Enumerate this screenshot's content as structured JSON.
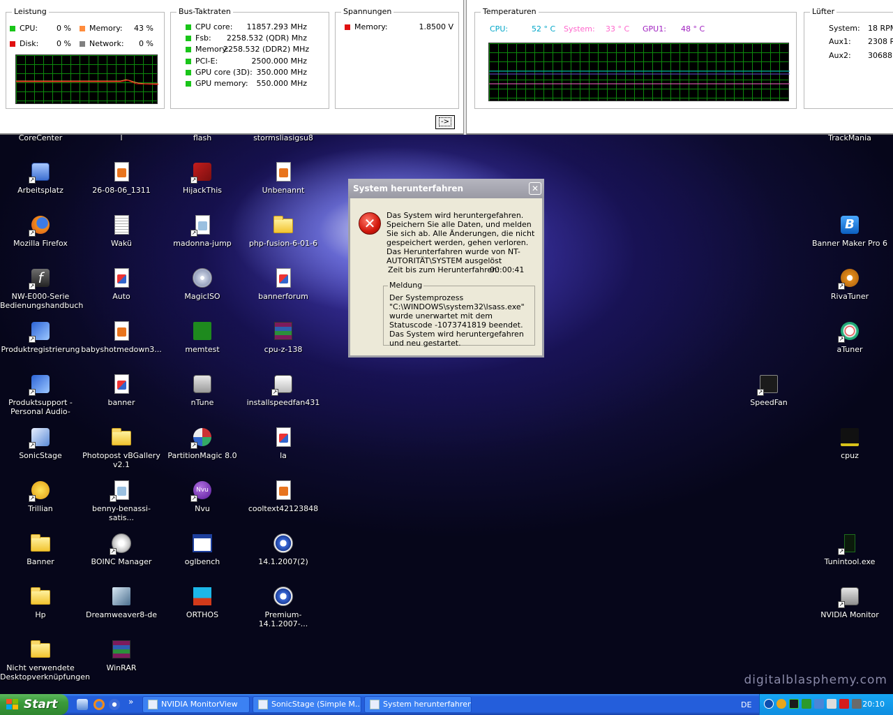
{
  "monitor": {
    "leistung": {
      "caption": "Leistung",
      "cpu_label": "CPU:",
      "cpu_value": "0 %",
      "memory_label": "Memory:",
      "memory_value": "43 %",
      "disk_label": "Disk:",
      "disk_value": "0 %",
      "network_label": "Network:",
      "network_value": "0 %"
    },
    "bus": {
      "caption": "Bus-Taktraten",
      "items": [
        {
          "label": "CPU core:",
          "value": "11857.293 MHz"
        },
        {
          "label": "Fsb:",
          "value": "2258.532 (QDR) Mhz"
        },
        {
          "label": "Memory:",
          "value": "2258.532 (DDR2) MHz"
        },
        {
          "label": "PCI-E:",
          "value": "2500.000 MHz"
        },
        {
          "label": "GPU core (3D):",
          "value": "350.000 MHz"
        },
        {
          "label": "GPU memory:",
          "value": "550.000 MHz"
        }
      ]
    },
    "spannungen": {
      "caption": "Spannungen",
      "label": "Memory:",
      "value": "1.8500 V"
    },
    "arrow_button": "->",
    "temperaturen": {
      "caption": "Temperaturen",
      "cpu_label": "CPU:",
      "cpu_value": "52 ° C",
      "system_label": "System:",
      "system_value": "33 ° C",
      "gpu_label": "GPU1:",
      "gpu_value": "48 ° C"
    },
    "luefter": {
      "caption": "Lüfter",
      "items": [
        {
          "label": "System:",
          "value": "18 RPM"
        },
        {
          "label": "Aux1:",
          "value": "2308 RP"
        },
        {
          "label": "Aux2:",
          "value": "30688 R"
        }
      ]
    },
    "colors": {
      "green": "#19c519",
      "orange": "#ff8c3c",
      "red": "#e01010",
      "gray": "#808080",
      "cyan": "#00a6c8",
      "pink": "#ff66cc",
      "purple": "#a020c0"
    }
  },
  "desktop": {
    "top_labels": [
      "CoreCenter",
      "l",
      "flash",
      "stormsliasigsu8",
      "TrackMania"
    ],
    "icons": [
      {
        "label": "Arbeitsplatz",
        "icon": "computer-icon"
      },
      {
        "label": "26-08-06_1311",
        "icon": "image-file-icon"
      },
      {
        "label": "HijackThis",
        "icon": "hijackthis-icon"
      },
      {
        "label": "Unbenannt",
        "icon": "image-file-icon"
      },
      {
        "label": "Mozilla Firefox",
        "icon": "firefox-icon"
      },
      {
        "label": "Wakü",
        "icon": "text-file-icon"
      },
      {
        "label": "madonna-jump",
        "icon": "media-shortcut-icon"
      },
      {
        "label": "php-fusion-6-01-6",
        "icon": "folder-icon"
      },
      {
        "label": "NW-E000-Serie Bedienungshandbuch",
        "icon": "flash-icon"
      },
      {
        "label": "Auto",
        "icon": "image-file-icon"
      },
      {
        "label": "MagicISO",
        "icon": "disc-icon"
      },
      {
        "label": "bannerforum",
        "icon": "image-file-icon"
      },
      {
        "label": "Produktregistrierung",
        "icon": "sony-icon"
      },
      {
        "label": "babyshotmedown3...",
        "icon": "image-file-icon"
      },
      {
        "label": "memtest",
        "icon": "memtest-icon"
      },
      {
        "label": "cpu-z-138",
        "icon": "winrar-icon"
      },
      {
        "label": "Produktsupport -Personal Audio-",
        "icon": "sony-icon"
      },
      {
        "label": "banner",
        "icon": "image-file-icon"
      },
      {
        "label": "nTune",
        "icon": "nvidia-icon"
      },
      {
        "label": "installspeedfan431",
        "icon": "installer-icon"
      },
      {
        "label": "SonicStage",
        "icon": "sonicstage-icon"
      },
      {
        "label": "Photopost vBGallery v2.1",
        "icon": "folder-icon"
      },
      {
        "label": "PartitionMagic 8.0",
        "icon": "partitionmagic-icon"
      },
      {
        "label": "la",
        "icon": "image-file-icon"
      },
      {
        "label": "Trillian",
        "icon": "trillian-icon"
      },
      {
        "label": "benny-benassi-satis...",
        "icon": "media-shortcut-icon"
      },
      {
        "label": "Nvu",
        "icon": "nvu-icon"
      },
      {
        "label": "cooltext42123848",
        "icon": "image-file-icon"
      },
      {
        "label": "Banner",
        "icon": "folder-icon"
      },
      {
        "label": "BOINC Manager",
        "icon": "boinc-icon"
      },
      {
        "label": "oglbench",
        "icon": "window-icon"
      },
      {
        "label": "14.1.2007(2)",
        "icon": "media-player-icon"
      },
      {
        "label": "Hp",
        "icon": "folder-icon"
      },
      {
        "label": "Dreamweaver8-de",
        "icon": "dreamweaver-icon"
      },
      {
        "label": "ORTHOS",
        "icon": "orthos-icon"
      },
      {
        "label": "Premium-14.1.2007-...",
        "icon": "media-player-icon"
      },
      {
        "label": "Nicht verwendete Desktopverknüpfungen",
        "icon": "folder-icon"
      },
      {
        "label": "WinRAR",
        "icon": "winrar-icon"
      }
    ],
    "right_icons": [
      {
        "label": "Banner Maker Pro 6",
        "icon": "banner-maker-icon"
      },
      {
        "label": "RivaTuner",
        "icon": "rivatuner-icon"
      },
      {
        "label": "aTuner",
        "icon": "atuner-icon"
      },
      {
        "label": "SpeedFan",
        "icon": "speedfan-icon"
      },
      {
        "label": "cpuz",
        "icon": "cpuz-icon"
      },
      {
        "label": "Tunintool.exe",
        "icon": "tunintool-icon"
      },
      {
        "label": "NVIDIA Monitor",
        "icon": "nvidia-monitor-icon"
      }
    ],
    "watermark": "digitalblasphemy.com"
  },
  "dialog": {
    "title": "System herunterfahren",
    "close": "✕",
    "message": "Das System wird heruntergefahren. Speichern Sie alle Daten, und melden Sie sich ab. Alle Änderungen, die nicht gespeichert werden, gehen verloren. Das Herunterfahren wurde von NT-AUTORITÄT\\SYSTEM ausgelöst",
    "time_label": "Zeit bis zum Herunterfahren:",
    "time_value": "00:00:41",
    "group_caption": "Meldung",
    "group_text": "Der Systemprozess \"C:\\WINDOWS\\system32\\lsass.exe\" wurde unerwartet mit dem Statuscode -1073741819 beendet. Das System wird heruntergefahren und neu gestartet."
  },
  "taskbar": {
    "start": "Start",
    "quicklaunch_more": "»",
    "buttons": [
      "NVIDIA MonitorView",
      "SonicStage (Simple M...",
      "System herunterfahren"
    ],
    "lang": "DE",
    "clock": "20:10"
  }
}
